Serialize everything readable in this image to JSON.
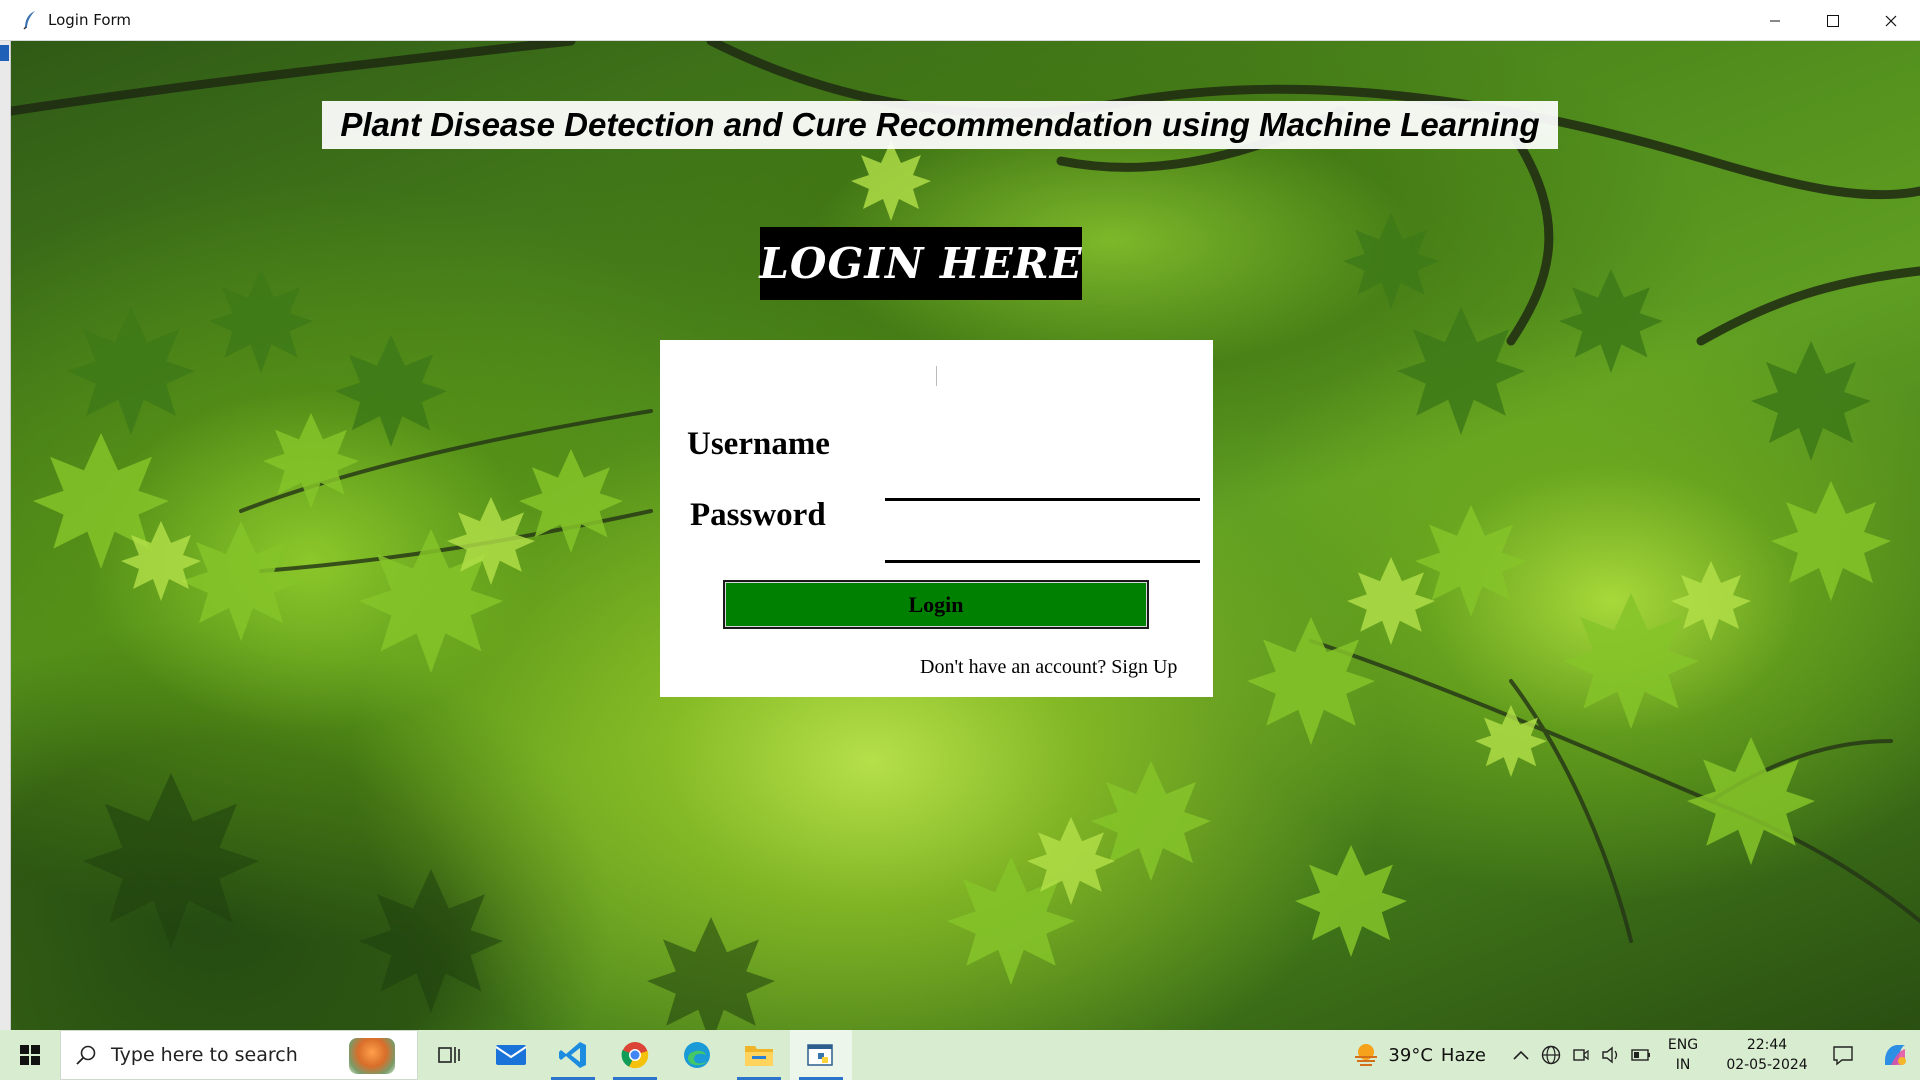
{
  "window": {
    "title": "Login Form",
    "app_icon": "feather-icon",
    "controls": [
      "minimize-icon",
      "maximize-icon",
      "close-icon"
    ]
  },
  "app": {
    "headline": "Plant Disease Detection and Cure Recommendation using Machine Learning",
    "banner": "LOGIN HERE",
    "form": {
      "username_label": "Username",
      "username_value": "",
      "password_label": "Password",
      "password_value": "",
      "login_button": "Login",
      "signup_text": "Don't have an account? Sign Up"
    },
    "colors": {
      "login_button": "#008000",
      "banner_bg": "#000000",
      "card_bg": "#ffffff"
    }
  },
  "taskbar": {
    "search_placeholder": "Type here to search",
    "apps": [
      {
        "name": "task-view-icon",
        "active": false
      },
      {
        "name": "mail-icon",
        "active": false
      },
      {
        "name": "vscode-icon",
        "active": true
      },
      {
        "name": "chrome-icon",
        "active": true
      },
      {
        "name": "edge-icon",
        "active": false
      },
      {
        "name": "file-explorer-icon",
        "active": true
      },
      {
        "name": "python-app-icon",
        "active": true
      }
    ],
    "weather": {
      "temp": "39°C",
      "condition": "Haze"
    },
    "language": {
      "line1": "ENG",
      "line2": "IN"
    },
    "clock": {
      "time": "22:44",
      "date": "02-05-2024"
    }
  }
}
